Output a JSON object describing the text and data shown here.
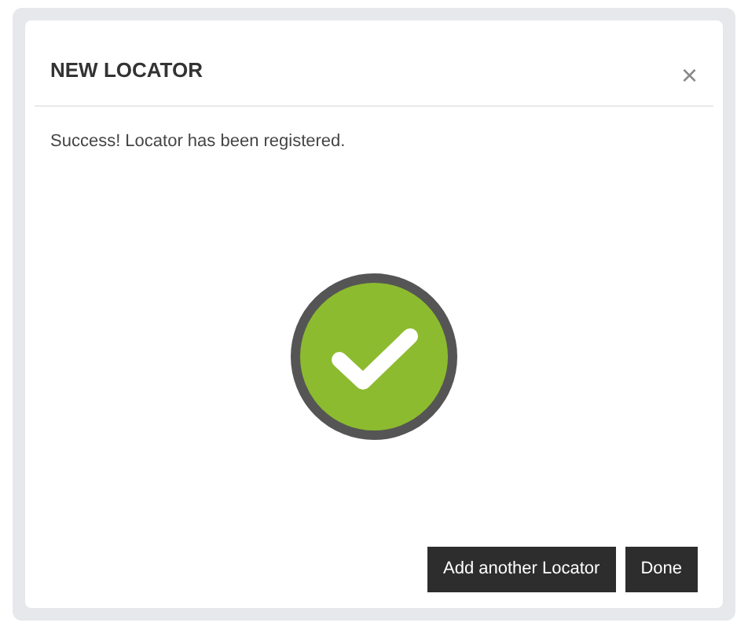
{
  "dialog": {
    "title": "NEW LOCATOR",
    "close": "×",
    "message": "Success! Locator has been registered."
  },
  "buttons": [
    {
      "label": "Add another Locator"
    },
    {
      "label": "Done"
    }
  ]
}
